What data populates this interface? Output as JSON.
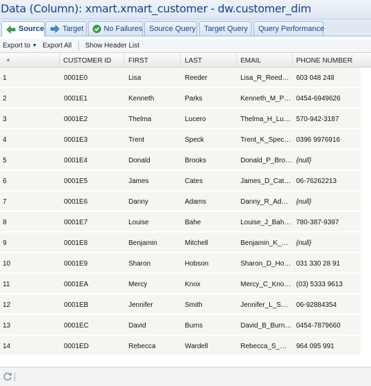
{
  "window": {
    "title": "Data (Column): xmart.xmart_customer - dw.customer_dim"
  },
  "tabs": [
    {
      "label": "Source",
      "icon": "arrow-left-icon",
      "active": true
    },
    {
      "label": "Target",
      "icon": "arrow-right-icon",
      "active": false
    },
    {
      "label": "No Failures",
      "icon": "check-circle-icon",
      "active": false
    },
    {
      "label": "Source Query",
      "active": false
    },
    {
      "label": "Target Query",
      "active": false
    },
    {
      "label": "Query Performance",
      "active": false
    }
  ],
  "toolbar": {
    "export_to": "Export to",
    "export_all": "Export All",
    "show_header_list": "Show Header List"
  },
  "columns": [
    "CUSTOMER ID",
    "FIRST",
    "LAST",
    "EMAIL",
    "PHONE NUMBER"
  ],
  "rows": [
    {
      "n": "1",
      "id": "0001E0",
      "first": "Lisa",
      "last": "Reeder",
      "email": "Lisa_R_Reed…",
      "phone": "603 048 248"
    },
    {
      "n": "2",
      "id": "0001E1",
      "first": "Kenneth",
      "last": "Parks",
      "email": "Kenneth_M_P…",
      "phone": "0454-6949626"
    },
    {
      "n": "3",
      "id": "0001E2",
      "first": "Thelma",
      "last": "Lucero",
      "email": "Thelma_H_Lu…",
      "phone": "570-942-3187"
    },
    {
      "n": "4",
      "id": "0001E3",
      "first": "Trent",
      "last": "Speck",
      "email": "Trent_K_Spec…",
      "phone": "0396 9976916"
    },
    {
      "n": "5",
      "id": "0001E4",
      "first": "Donald",
      "last": "Brooks",
      "email": "Donald_P_Bro…",
      "phone": "{null}"
    },
    {
      "n": "6",
      "id": "0001E5",
      "first": "James",
      "last": "Cates",
      "email": "James_D_Cat…",
      "phone": "06-76262213"
    },
    {
      "n": "7",
      "id": "0001E6",
      "first": "Danny",
      "last": "Adams",
      "email": "Danny_R_Ad…",
      "phone": "{null}"
    },
    {
      "n": "8",
      "id": "0001E7",
      "first": "Louise",
      "last": "Bahe",
      "email": "Louise_J_Bah…",
      "phone": "780-387-9397"
    },
    {
      "n": "9",
      "id": "0001E8",
      "first": "Benjamin",
      "last": "Mitchell",
      "email": "Benjamin_K_…",
      "phone": "{null}"
    },
    {
      "n": "10",
      "id": "0001E9",
      "first": "Sharon",
      "last": "Hobson",
      "email": "Sharon_D_Ho…",
      "phone": "031 330 28 91"
    },
    {
      "n": "11",
      "id": "0001EA",
      "first": "Mercy",
      "last": "Knox",
      "email": "Mercy_C_Kno…",
      "phone": "(03) 5333 9613"
    },
    {
      "n": "12",
      "id": "0001EB",
      "first": "Jennifer",
      "last": "Smith",
      "email": "Jennifer_L_S…",
      "phone": "06-92884354"
    },
    {
      "n": "13",
      "id": "0001EC",
      "first": "David",
      "last": "Burns",
      "email": "David_B_Burn…",
      "phone": "0454-7879660"
    },
    {
      "n": "14",
      "id": "0001ED",
      "first": "Rebecca",
      "last": "Wardell",
      "email": "Rebecca_S_…",
      "phone": "964 095 991"
    }
  ],
  "colors": {
    "title": "#15428b",
    "tab_border": "#99bbe8",
    "row_bg": "#f5f5f2",
    "check_green": "#3aa64a"
  }
}
